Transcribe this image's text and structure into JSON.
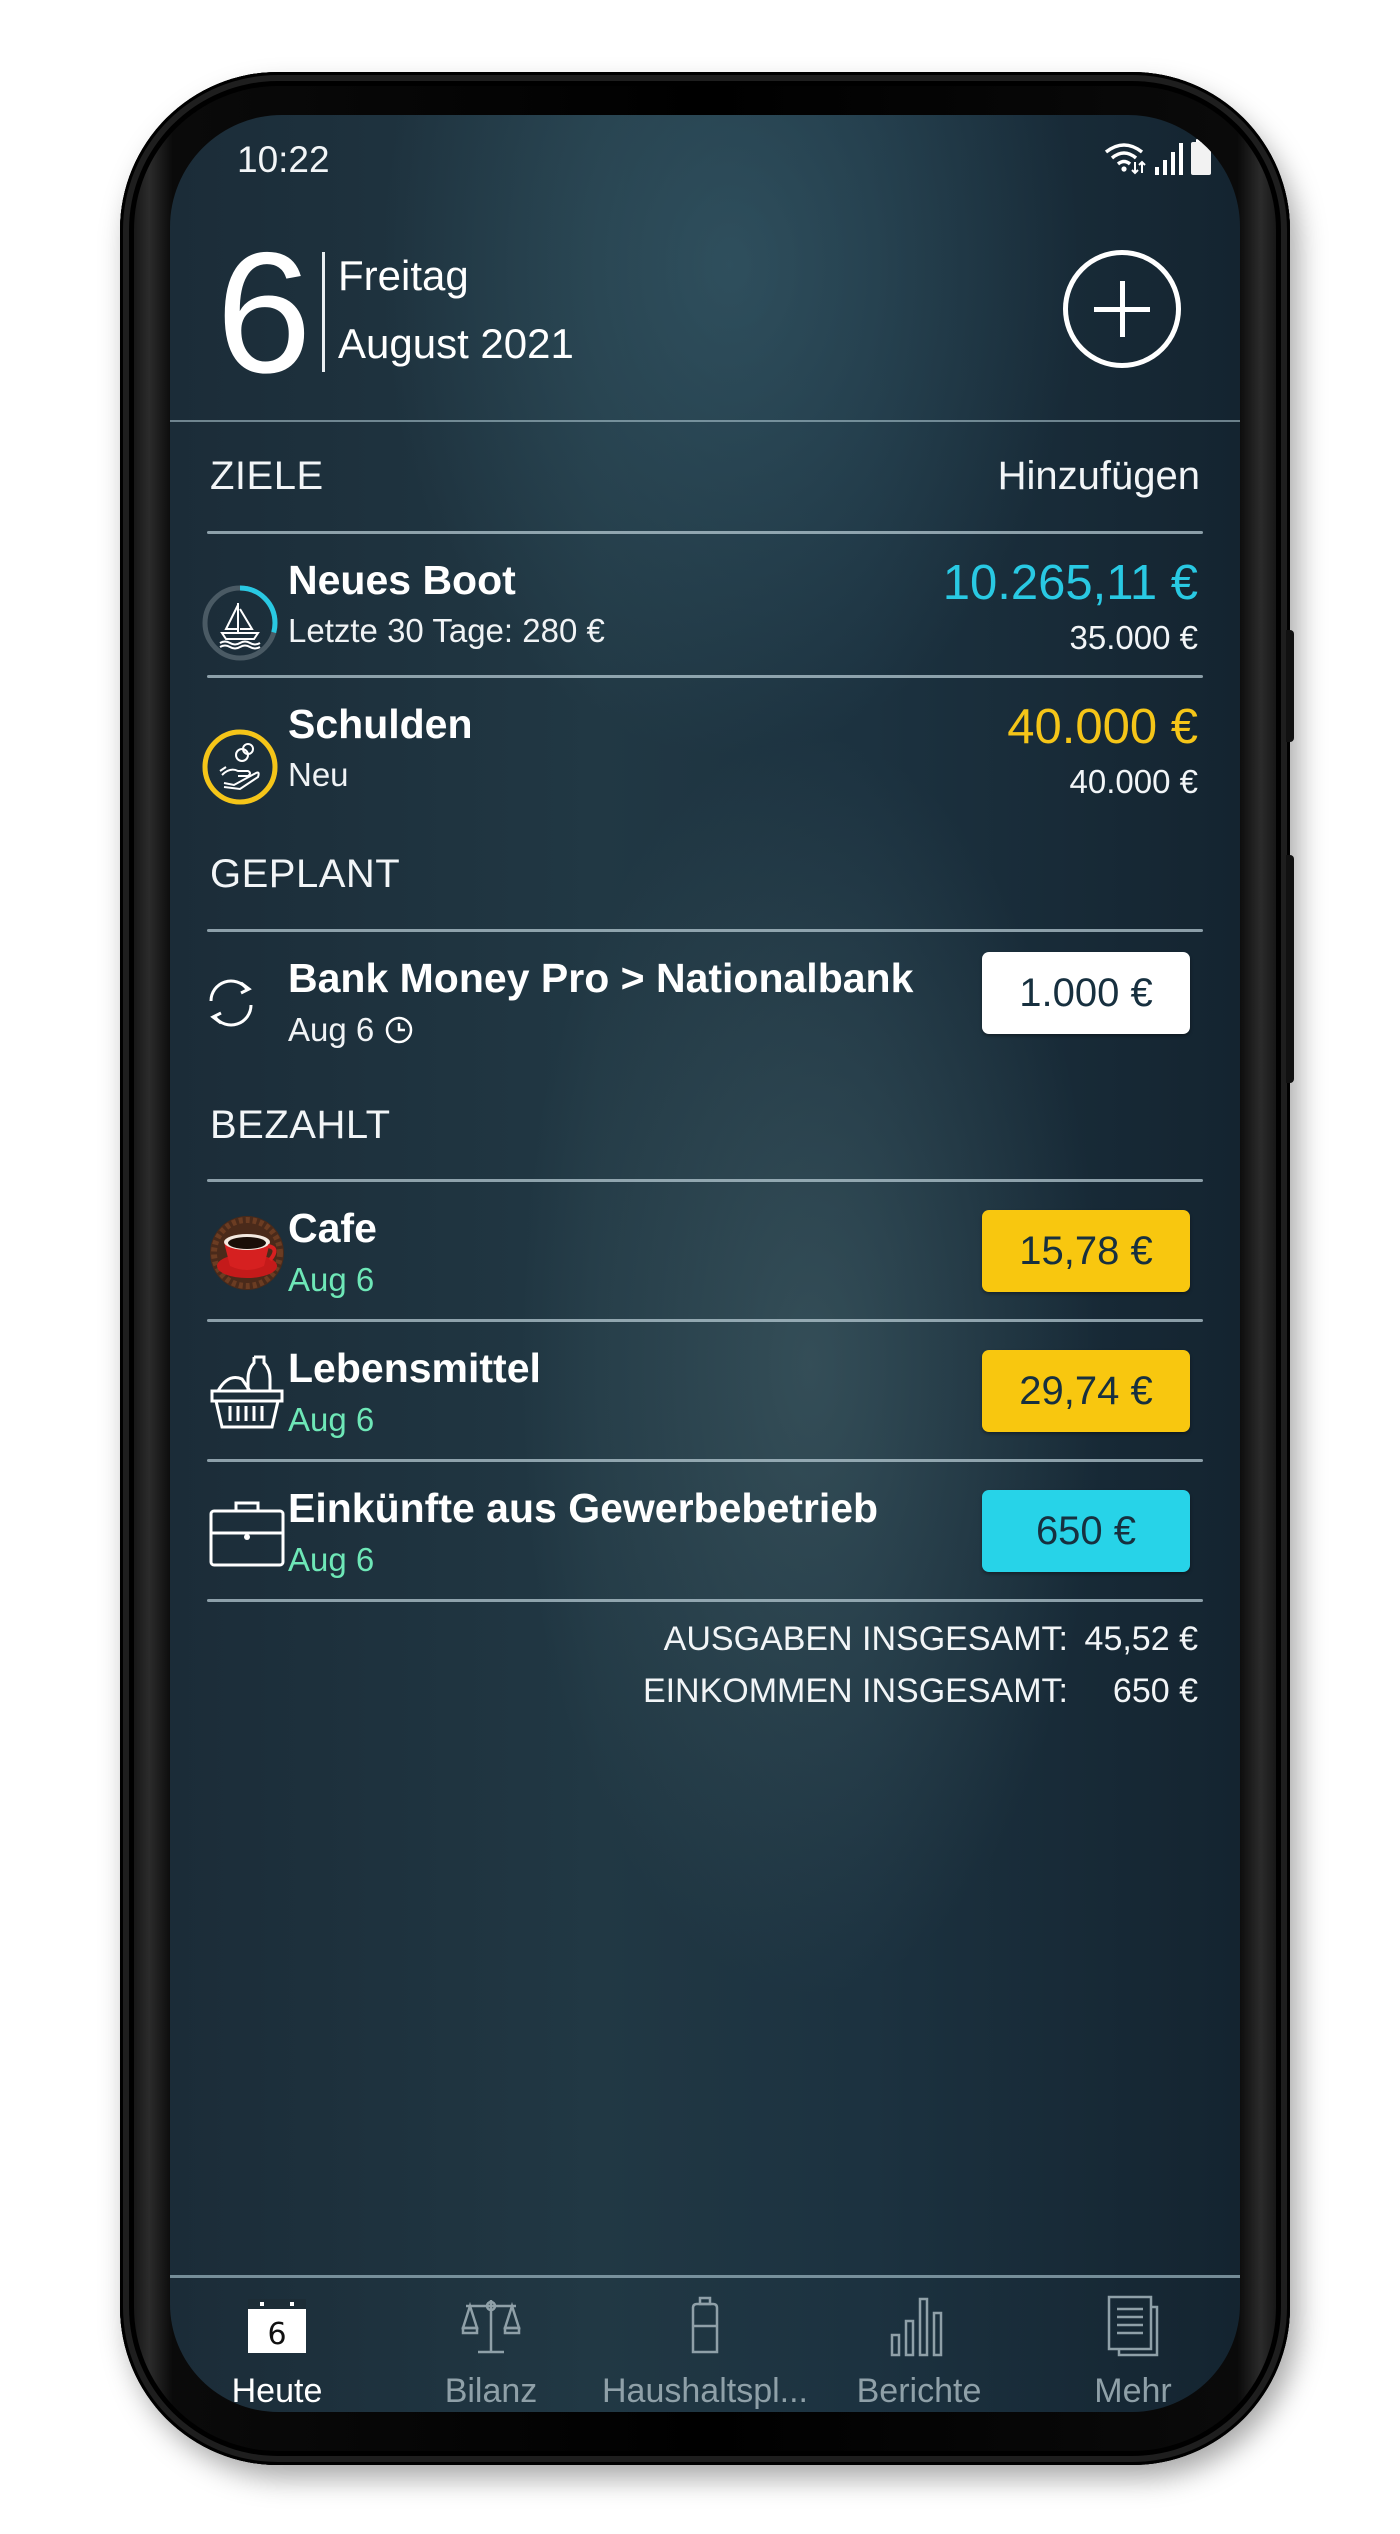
{
  "status_bar": {
    "time": "10:22",
    "icons": [
      "wifi-data-icon",
      "cell-signal-icon",
      "battery-icon"
    ]
  },
  "header": {
    "day": "6",
    "weekday": "Freitag",
    "month_year": "August 2021",
    "add_icon": "plus-circle-icon"
  },
  "goals": {
    "title": "ZIELE",
    "add_label": "Hinzufügen",
    "items": [
      {
        "name": "Neues Boot",
        "subtitle": "Letzte 30 Tage: 280 €",
        "current": "10.265,11 €",
        "target": "35.000 €",
        "progress": 0.293,
        "icon": "sailboat-icon",
        "color": "#29c9e3"
      },
      {
        "name": "Schulden",
        "subtitle": "Neu",
        "current": "40.000 €",
        "target": "40.000 €",
        "progress": 1.0,
        "icon": "hand-coins-icon",
        "color": "#f5c518"
      }
    ]
  },
  "planned": {
    "title": "GEPLANT",
    "items": [
      {
        "name": "Bank Money Pro > Nationalbank",
        "date": "Aug 6",
        "amount": "1.000 €",
        "icon": "transfer-sync-icon",
        "badge_color": "#ffffff"
      }
    ]
  },
  "paid": {
    "title": "BEZAHLT",
    "items": [
      {
        "name": "Cafe",
        "date": "Aug 6",
        "amount": "15,78 €",
        "icon": "coffee-cup-icon",
        "badge_color": "#f8c70f"
      },
      {
        "name": "Lebensmittel",
        "date": "Aug 6",
        "amount": "29,74 €",
        "icon": "grocery-basket-icon",
        "badge_color": "#f8c70f"
      },
      {
        "name": "Einkünfte aus Gewerbebetrieb",
        "date": "Aug 6",
        "amount": "650 €",
        "icon": "briefcase-icon",
        "badge_color": "#27d3e8"
      }
    ]
  },
  "totals": {
    "expenses_label": "AUSGABEN INSGESAMT:",
    "expenses_value": "45,52 €",
    "income_label": "EINKOMMEN INSGESAMT:",
    "income_value": "650 €"
  },
  "nav": {
    "items": [
      {
        "label": "Heute",
        "icon": "calendar-day-icon",
        "icon_text": "6",
        "active": true
      },
      {
        "label": "Bilanz",
        "icon": "balance-scale-icon",
        "active": false
      },
      {
        "label": "Haushaltspl...",
        "icon": "budget-jar-icon",
        "active": false
      },
      {
        "label": "Berichte",
        "icon": "bar-chart-icon",
        "active": false
      },
      {
        "label": "Mehr",
        "icon": "documents-icon",
        "active": false
      }
    ]
  },
  "colors": {
    "accent_cyan": "#29c9e3",
    "accent_yellow": "#f5c518",
    "date_green": "#6ee7b7",
    "pill_text": "#17303f"
  }
}
